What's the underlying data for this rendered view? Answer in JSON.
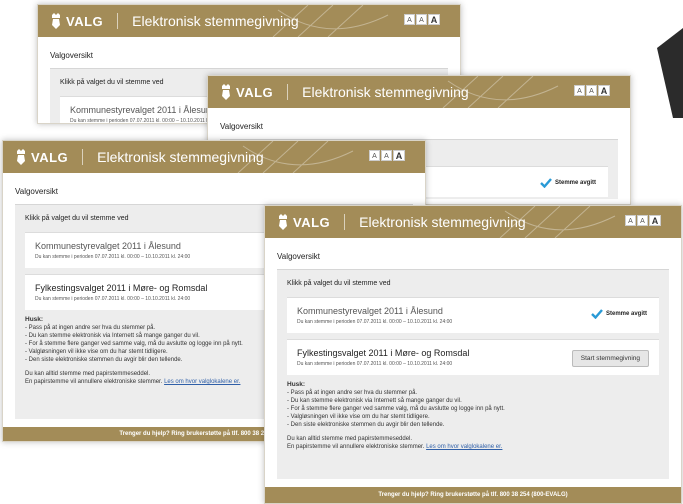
{
  "app": {
    "brand": "VALG",
    "title": "Elektronisk stemmegivning",
    "font_sizes": [
      "A",
      "A",
      "A"
    ]
  },
  "page": {
    "heading": "Valgoversikt",
    "instruction": "Klikk på valget du vil stemme ved"
  },
  "elections": [
    {
      "name": "Kommunestyrevalget 2011 i Ålesund",
      "period": "Du kan stemme i perioden  07.07.2011 kl. 00:00 – 10.10.2011 kl. 24:00",
      "status": "Stemme avgitt"
    },
    {
      "name": "Fylkestingsvalget 2011 i Møre- og Romsdal",
      "period": "Du kan stemme i perioden  07.07.2011 kl. 00:00 – 10.10.2011 kl. 24:00",
      "action": "Start stemmegivning"
    }
  ],
  "reminder": {
    "title": "Husk:",
    "items": [
      "- Pass på at ingen andre ser hva du stemmer på.",
      "- Du kan stemme elektronisk via Internett så mange ganger du vil.",
      "- For å stemme flere ganger ved samme valg, må du avslutte og logge inn på nytt.",
      "- Valgløsningen vil ikke vise om du har stemt tidligere.",
      "- Den siste elektroniske stemmen du avgir blir den tellende."
    ],
    "note1": "Du kan alltid stemme med papirstemmeseddel.",
    "note2": "En papirstemme vil annullere elektroniske stemmer.",
    "link": "Les om hvor valglokalene er."
  },
  "footer": {
    "help": "Trenger du hjelp? Ring brukerstøtte på tlf. 800 38 254 (800-EVALG)"
  },
  "colors": {
    "header": "#a38c58",
    "check": "#2a9ad6",
    "link": "#2f5fa8"
  }
}
